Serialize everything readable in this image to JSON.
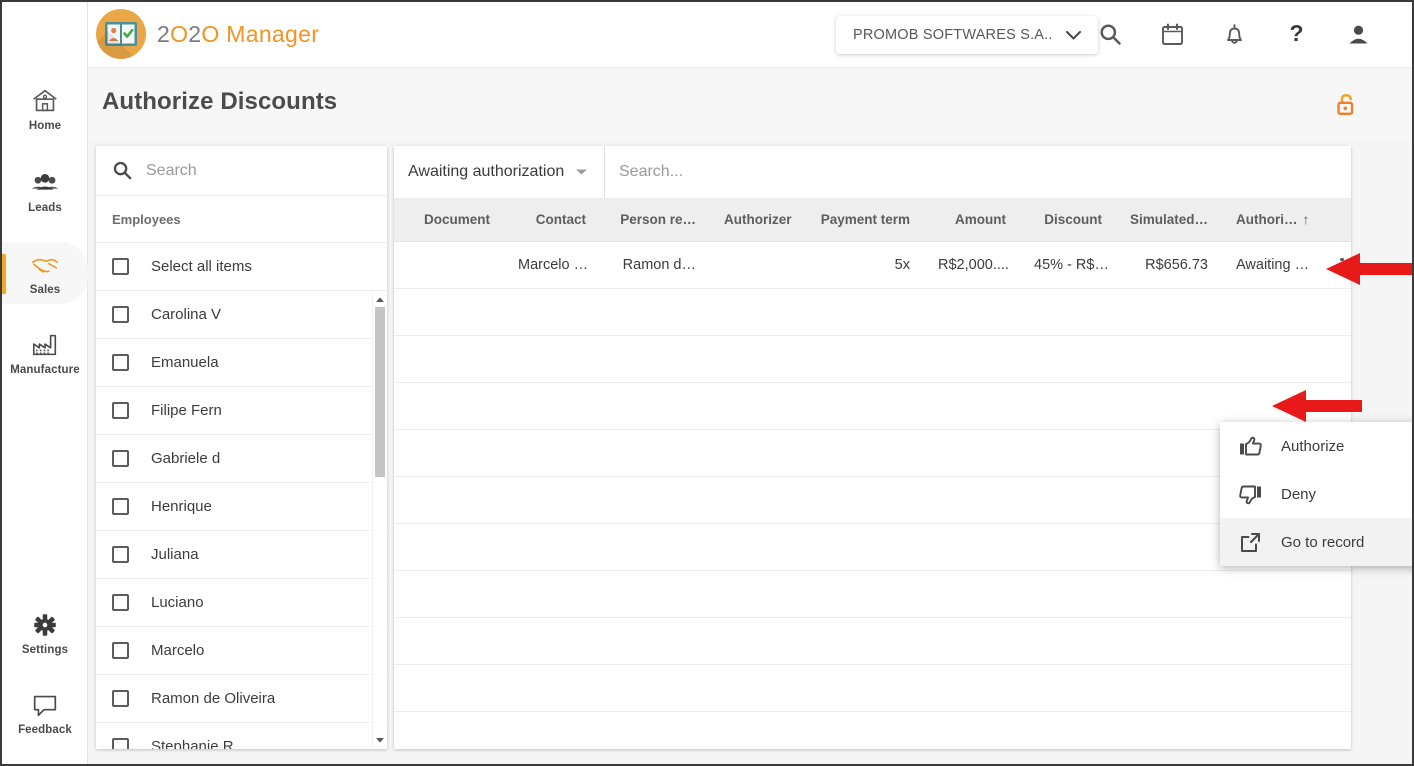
{
  "brand": {
    "logo_icon": "badge-checklist-icon",
    "text_parts": [
      "2",
      "O2O",
      " Manager"
    ],
    "full_text": "2O2O Manager"
  },
  "topbar": {
    "company": {
      "label": "PROMOB SOFTWARES S.A..",
      "chevron_icon": "chevron-down-icon"
    },
    "icons": [
      {
        "name": "search-icon",
        "label": "Search"
      },
      {
        "name": "calendar-icon",
        "label": "Calendar"
      },
      {
        "name": "bell-icon",
        "label": "Notifications"
      },
      {
        "name": "question-mark-icon",
        "label": "Help"
      },
      {
        "name": "user-avatar-icon",
        "label": "Account"
      }
    ]
  },
  "rail": {
    "items": [
      {
        "label": "Home",
        "icon": "home-icon",
        "active": false
      },
      {
        "label": "Leads",
        "icon": "people-group-icon",
        "active": false
      },
      {
        "label": "Sales",
        "icon": "handshake-icon",
        "active": true
      },
      {
        "label": "Manufacture",
        "icon": "factory-icon",
        "active": false
      },
      {
        "label": "Settings",
        "icon": "gear-icon",
        "active": false
      },
      {
        "label": "Feedback",
        "icon": "speech-bubble-icon",
        "active": false
      }
    ]
  },
  "page": {
    "title": "Authorize Discounts",
    "lock_icon": "unlock-padlock-icon",
    "lock_color": "#f7941e"
  },
  "employees_panel": {
    "search": {
      "placeholder": "Search",
      "value": "",
      "icon": "search-icon"
    },
    "group_header": "Employees",
    "select_all_label": "Select all items",
    "rows": [
      {
        "name": "Carolina V",
        "checked": false
      },
      {
        "name": "Emanuela",
        "checked": false
      },
      {
        "name": "Filipe Fern",
        "checked": false
      },
      {
        "name": "Gabriele d",
        "checked": false
      },
      {
        "name": "Henrique",
        "checked": false
      },
      {
        "name": "Juliana",
        "checked": false
      },
      {
        "name": "Luciano",
        "checked": false
      },
      {
        "name": "Marcelo",
        "checked": false
      },
      {
        "name": "Ramon de Oliveira",
        "checked": false
      },
      {
        "name": "Stephanie R",
        "checked": false
      }
    ],
    "scrollbar": {
      "up_icon": "caret-up-icon",
      "down_icon": "caret-down-icon"
    }
  },
  "table_panel": {
    "filter": {
      "value": "Awaiting authorization",
      "chevron_icon": "chevron-down-icon"
    },
    "search": {
      "placeholder": "Search...",
      "value": ""
    },
    "columns": [
      {
        "key": "document",
        "label": "Document",
        "sorted": false
      },
      {
        "key": "contact",
        "label": "Contact",
        "sorted": false
      },
      {
        "key": "person_responsible",
        "label": "Person re…",
        "sorted": false
      },
      {
        "key": "authorizer",
        "label": "Authorizer",
        "sorted": false
      },
      {
        "key": "payment_term",
        "label": "Payment term",
        "sorted": false
      },
      {
        "key": "amount",
        "label": "Amount",
        "sorted": false
      },
      {
        "key": "discount",
        "label": "Discount",
        "sorted": false
      },
      {
        "key": "simulated",
        "label": "Simulated…",
        "sorted": false
      },
      {
        "key": "authorization",
        "label": "Authori…",
        "sorted": true,
        "sort_icon": "↑"
      }
    ],
    "rows": [
      {
        "document": "",
        "contact": "Marcelo …",
        "person_responsible": "Ramon d…",
        "authorizer": "",
        "payment_term": "5x",
        "amount": "R$2,000....",
        "discount": "45% - R$…",
        "simulated": "R$656.73",
        "authorization": "Awaiting …",
        "actions_icon": "kebab-menu-icon"
      }
    ]
  },
  "context_menu": {
    "items": [
      {
        "label": "Authorize",
        "icon": "thumbs-up-icon",
        "highlighted": false
      },
      {
        "label": "Deny",
        "icon": "thumbs-down-icon",
        "highlighted": false
      },
      {
        "label": "Go to record",
        "icon": "external-link-icon",
        "highlighted": true
      }
    ]
  },
  "annotations": {
    "arrow_color": "#e81919",
    "arrows": [
      {
        "name": "arrow-to-kebab-menu",
        "points_at": "kebab-menu-icon"
      },
      {
        "name": "arrow-to-go-to-record",
        "points_at": "Go to record"
      }
    ]
  }
}
